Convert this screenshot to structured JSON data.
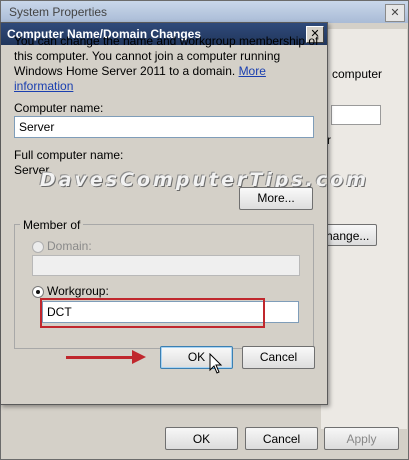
{
  "background_window": {
    "title": "System Properties",
    "close_symbol": "✕",
    "right_text_1": "computer",
    "right_text_2": "r",
    "change_button": "hange...",
    "ok_label": "OK",
    "cancel_label": "Cancel",
    "apply_label": "Apply"
  },
  "dialog": {
    "title": "Computer Name/Domain Changes",
    "close_symbol": "✕",
    "description": "You can change the name and workgroup membership of this computer. You cannot join a computer running Windows Home Server 2011 to a domain. ",
    "more_info_link": "More information",
    "computer_name_label": "Computer name:",
    "computer_name_value": "Server",
    "full_name_label": "Full computer name:",
    "full_name_value": "Server",
    "more_button": "More...",
    "member_of_label": "Member of",
    "domain_label": "Domain:",
    "domain_value": "",
    "workgroup_label": "Workgroup:",
    "workgroup_value": "DCT",
    "workgroup_selected": true,
    "ok_label": "OK",
    "cancel_label": "Cancel"
  },
  "watermark": "DavesComputerTips.com",
  "colors": {
    "dialog_title_bar": "#21365c",
    "annotation_red": "#c0272d",
    "link": "#1a3fb0"
  },
  "icons": [
    "close-icon",
    "radio-icon",
    "mouse-cursor-icon",
    "red-arrow-annotation"
  ]
}
